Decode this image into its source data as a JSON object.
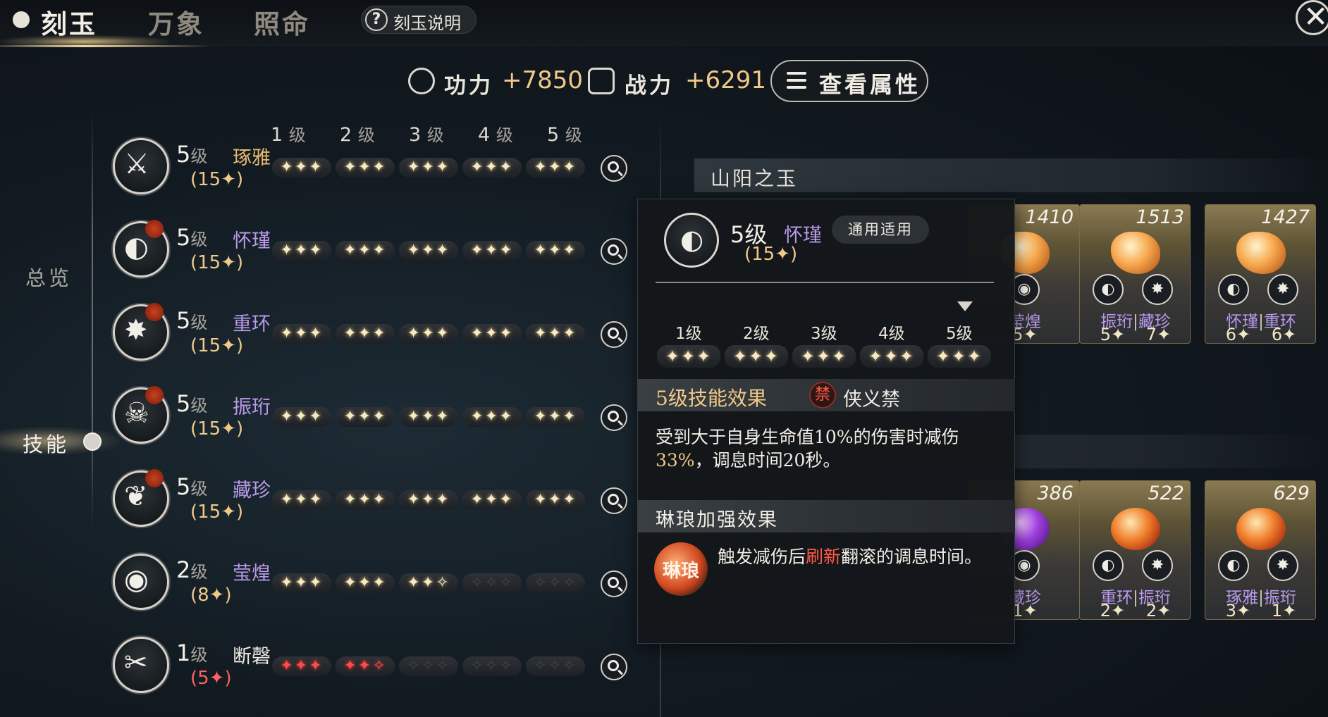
{
  "tabs": [
    {
      "label": "刻玉",
      "active": true
    },
    {
      "label": "万象",
      "active": false
    },
    {
      "label": "照命",
      "active": false
    }
  ],
  "help": {
    "icon": "?",
    "label": "刻玉说明"
  },
  "close": {
    "icon": "✕"
  },
  "stats": {
    "gongli_label": "功力",
    "gongli_value": "+7850",
    "zhanli_label": "战力",
    "zhanli_value": "+6291",
    "view_attr_label": "查看属性"
  },
  "nav": {
    "overview": "总览",
    "skills": "技能"
  },
  "level_headers": [
    {
      "num": "1",
      "unit": "级"
    },
    {
      "num": "2",
      "unit": "级"
    },
    {
      "num": "3",
      "unit": "级"
    },
    {
      "num": "4",
      "unit": "级"
    },
    {
      "num": "5",
      "unit": "级"
    }
  ],
  "skills": [
    {
      "level": "5",
      "unit": "级",
      "name": "琢雅",
      "points": "(15✦)",
      "glyph": "⚔",
      "stars": [
        3,
        3,
        3,
        3,
        3
      ]
    },
    {
      "level": "5",
      "unit": "级",
      "name": "怀瑾",
      "points": "(15✦)",
      "glyph": "◐",
      "stars": [
        3,
        3,
        3,
        3,
        3
      ]
    },
    {
      "level": "5",
      "unit": "级",
      "name": "重环",
      "points": "(15✦)",
      "glyph": "✸",
      "stars": [
        3,
        3,
        3,
        3,
        3
      ]
    },
    {
      "level": "5",
      "unit": "级",
      "name": "振珩",
      "points": "(15✦)",
      "glyph": "☠",
      "stars": [
        3,
        3,
        3,
        3,
        3
      ]
    },
    {
      "level": "5",
      "unit": "级",
      "name": "藏珍",
      "points": "(15✦)",
      "glyph": "❦",
      "stars": [
        3,
        3,
        3,
        3,
        3
      ]
    },
    {
      "level": "2",
      "unit": "级",
      "name": "莹煌",
      "points": "(8✦)",
      "glyph": "◉",
      "stars": [
        3,
        3,
        2,
        0,
        0
      ]
    },
    {
      "level": "1",
      "unit": "级",
      "name": "断磬",
      "points": "(5✦)",
      "glyph": "✂",
      "stars": [
        3,
        2,
        0,
        0,
        0
      ]
    }
  ],
  "section1": {
    "title": "山阳之玉"
  },
  "cards_top": [
    {
      "number": "1410",
      "names": [
        "莹煌"
      ],
      "pts": [
        "5✦"
      ]
    },
    {
      "number": "1513",
      "names": [
        "振珩",
        "藏珍"
      ],
      "pts": [
        "5✦",
        "7✦"
      ]
    },
    {
      "number": "1427",
      "names": [
        "怀瑾",
        "重环"
      ],
      "pts": [
        "6✦",
        "6✦"
      ]
    }
  ],
  "cards_bottom": [
    {
      "number": "386",
      "names": [
        "藏珍"
      ],
      "pts": [
        "1✦"
      ]
    },
    {
      "number": "522",
      "names": [
        "重环",
        "振珩"
      ],
      "pts": [
        "2✦",
        "2✦"
      ]
    },
    {
      "number": "629",
      "names": [
        "琢雅",
        "振珩"
      ],
      "pts": [
        "3✦",
        "1✦"
      ]
    }
  ],
  "popup": {
    "level": "5级",
    "name": "怀瑾",
    "badge": "通用适用",
    "points": "(15✦)",
    "columns": [
      "1级",
      "2级",
      "3级",
      "4级",
      "5级"
    ],
    "effect_title": "5级技能效果",
    "seal_char": "禁",
    "seal_name": "侠义禁",
    "effect_text_a": "受到大于自身生命值10%的伤害时减伤",
    "effect_text_hl": "33%",
    "effect_text_b": "，调息时间20秒。",
    "enhance_title": "琳琅加强效果",
    "enhance_icon": "琳琅",
    "enhance_a": "触发减伤后",
    "enhance_hl": "刷新",
    "enhance_b": "翻滚的调息时间。"
  },
  "colors": {
    "gold": "#f0c989",
    "purple": "#b89ae8",
    "red": "#ff5a47"
  }
}
